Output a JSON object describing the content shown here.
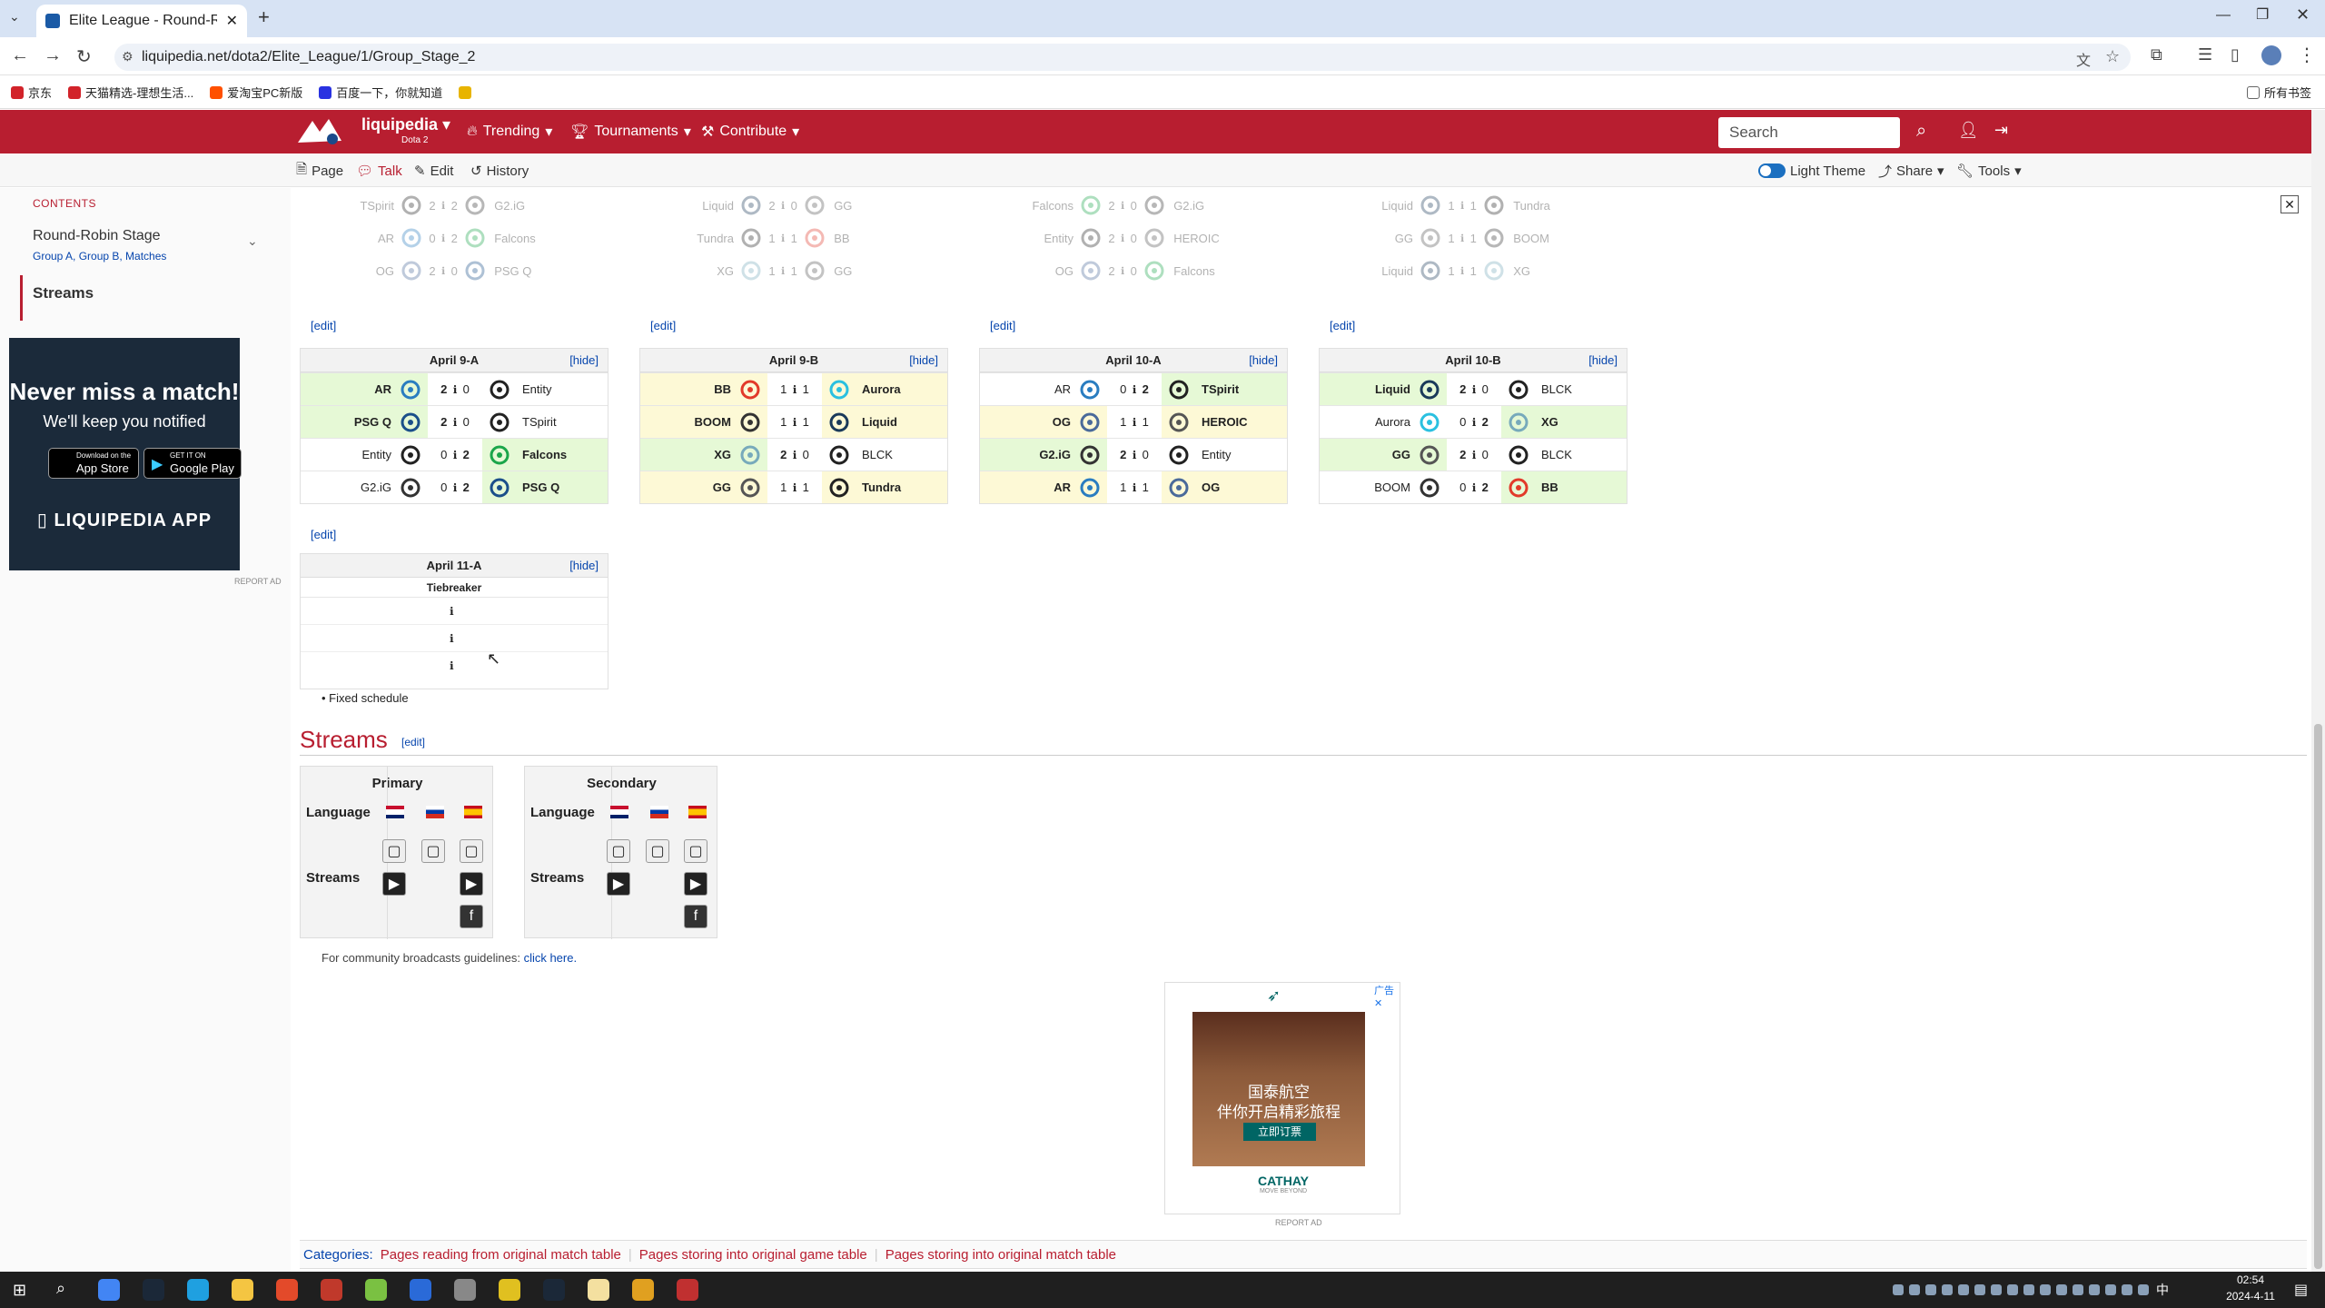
{
  "browser": {
    "tab_title": "Elite League - Round-Robin S",
    "url": "liquipedia.net/dota2/Elite_League/1/Group_Stage_2",
    "bookmarks": [
      "京东",
      "天猫精选-理想生活...",
      "爱淘宝PC新版",
      "百度一下，你就知道",
      "所有书签"
    ]
  },
  "lpnav": {
    "logo": "liquipedia",
    "logo_sub": "Dota 2",
    "items": [
      "Trending",
      "Tournaments",
      "Contribute"
    ],
    "search_placeholder": "Search"
  },
  "subnav": {
    "items": [
      "Page",
      "Talk",
      "Edit",
      "History"
    ],
    "theme": "Light Theme",
    "share": "Share",
    "tools": "Tools"
  },
  "sidebar": {
    "contents_label": "CONTENTS",
    "item1": "Round-Robin Stage",
    "item1_sub": "Group A, Group B, Matches",
    "item2": "Streams",
    "ad_title": "Never miss a match!",
    "ad_sub": "We'll keep you notified",
    "appstore": "App Store",
    "appstore_small": "Download on the",
    "googleplay": "Google Play",
    "googleplay_small": "GET IT ON",
    "app_label": "LIQUIPEDIA APP",
    "report_ad": "REPORT AD"
  },
  "edit_label": "[edit]",
  "hide_label": "[hide]",
  "faded_rows": [
    [
      [
        "TSpirit",
        "2",
        "0",
        "2",
        "G2.iG"
      ],
      [
        "AR",
        "0",
        "0",
        "2",
        "Falcons"
      ],
      [
        "OG",
        "2",
        "0",
        "0",
        "PSG Q"
      ]
    ],
    [
      [
        "Liquid",
        "2",
        "0",
        "0",
        "GG"
      ],
      [
        "Tundra",
        "1",
        "0",
        "1",
        "BB"
      ],
      [
        "XG",
        "1",
        "0",
        "1",
        "GG"
      ]
    ],
    [
      [
        "Falcons",
        "2",
        "0",
        "0",
        "G2.iG"
      ],
      [
        "Entity",
        "2",
        "0",
        "0",
        "HEROIC"
      ],
      [
        "OG",
        "2",
        "0",
        "0",
        "Falcons"
      ]
    ],
    [
      [
        "Liquid",
        "1",
        "0",
        "1",
        "Tundra"
      ],
      [
        "GG",
        "1",
        "0",
        "1",
        "BOOM"
      ],
      [
        "Liquid",
        "1",
        "0",
        "1",
        "XG"
      ]
    ]
  ],
  "brackets": [
    {
      "title": "April 9-A",
      "rows": [
        {
          "t1": "AR",
          "s1": "2",
          "s2": "0",
          "t2": "Entity",
          "res": "left"
        },
        {
          "t1": "PSG Q",
          "s1": "2",
          "s2": "0",
          "t2": "TSpirit",
          "res": "left"
        },
        {
          "t1": "Entity",
          "s1": "0",
          "s2": "2",
          "t2": "Falcons",
          "res": "right"
        },
        {
          "t1": "G2.iG",
          "s1": "0",
          "s2": "2",
          "t2": "PSG Q",
          "res": "right"
        }
      ]
    },
    {
      "title": "April 9-B",
      "rows": [
        {
          "t1": "BB",
          "s1": "1",
          "s2": "1",
          "t2": "Aurora",
          "res": "draw"
        },
        {
          "t1": "BOOM",
          "s1": "1",
          "s2": "1",
          "t2": "Liquid",
          "res": "draw"
        },
        {
          "t1": "XG",
          "s1": "2",
          "s2": "0",
          "t2": "BLCK",
          "res": "left"
        },
        {
          "t1": "GG",
          "s1": "1",
          "s2": "1",
          "t2": "Tundra",
          "res": "draw"
        }
      ]
    },
    {
      "title": "April 10-A",
      "rows": [
        {
          "t1": "AR",
          "s1": "0",
          "s2": "2",
          "t2": "TSpirit",
          "res": "right"
        },
        {
          "t1": "OG",
          "s1": "1",
          "s2": "1",
          "t2": "HEROIC",
          "res": "draw"
        },
        {
          "t1": "G2.iG",
          "s1": "2",
          "s2": "0",
          "t2": "Entity",
          "res": "left"
        },
        {
          "t1": "AR",
          "s1": "1",
          "s2": "1",
          "t2": "OG",
          "res": "draw"
        }
      ]
    },
    {
      "title": "April 10-B",
      "rows": [
        {
          "t1": "Liquid",
          "s1": "2",
          "s2": "0",
          "t2": "BLCK",
          "res": "left"
        },
        {
          "t1": "Aurora",
          "s1": "0",
          "s2": "2",
          "t2": "XG",
          "res": "right"
        },
        {
          "t1": "GG",
          "s1": "2",
          "s2": "0",
          "t2": "BLCK",
          "res": "left"
        },
        {
          "t1": "BOOM",
          "s1": "0",
          "s2": "2",
          "t2": "BB",
          "res": "right"
        }
      ]
    }
  ],
  "tiebreaker": {
    "title": "April 11-A",
    "label": "Tiebreaker"
  },
  "note": "Fixed schedule",
  "streams": {
    "heading": "Streams",
    "primary": "Primary",
    "secondary": "Secondary",
    "language": "Language",
    "streams": "Streams",
    "community_text": "For community broadcasts guidelines:",
    "community_link": "click here."
  },
  "ad": {
    "line1": "国泰航空",
    "line2": "伴你开启精彩旅程",
    "button": "立即订票",
    "brand": "CATHAY",
    "brand_sub": "MOVE BEYOND",
    "adchoices": "广告",
    "report": "REPORT AD"
  },
  "categories": {
    "label": "Categories:",
    "items": [
      "Pages reading from original match table",
      "Pages storing into original game table",
      "Pages storing into original match table"
    ]
  },
  "taskbar": {
    "time": "02:54",
    "date": "2024-4-11",
    "ime": "中"
  }
}
